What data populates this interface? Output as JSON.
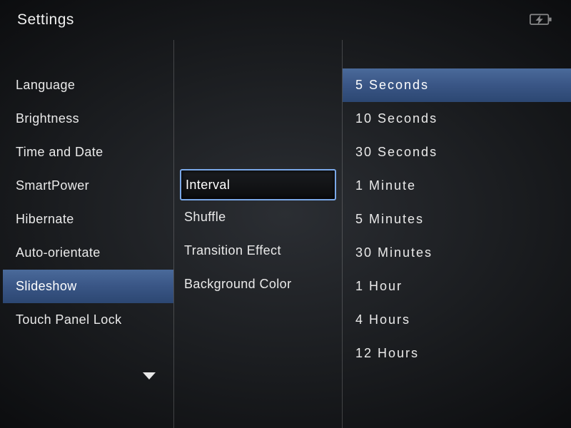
{
  "header": {
    "title": "Settings"
  },
  "col1": {
    "items": [
      {
        "label": "Language"
      },
      {
        "label": "Brightness"
      },
      {
        "label": "Time and Date"
      },
      {
        "label": "SmartPower"
      },
      {
        "label": "Hibernate"
      },
      {
        "label": "Auto-orientate"
      },
      {
        "label": "Slideshow"
      },
      {
        "label": "Touch Panel Lock"
      }
    ],
    "selectedIndex": 6
  },
  "col2": {
    "items": [
      {
        "label": "Interval"
      },
      {
        "label": "Shuffle"
      },
      {
        "label": "Transition Effect"
      },
      {
        "label": "Background Color"
      }
    ],
    "topOffset": 3,
    "focusedIndex": 0
  },
  "col3": {
    "items": [
      {
        "label": "5 Seconds"
      },
      {
        "label": "10 Seconds"
      },
      {
        "label": "30 Seconds"
      },
      {
        "label": "1 Minute"
      },
      {
        "label": "5 Minutes"
      },
      {
        "label": "30 Minutes"
      },
      {
        "label": "1 Hour"
      },
      {
        "label": "4 Hours"
      },
      {
        "label": "12 Hours"
      }
    ],
    "selectedIndex": 0
  }
}
